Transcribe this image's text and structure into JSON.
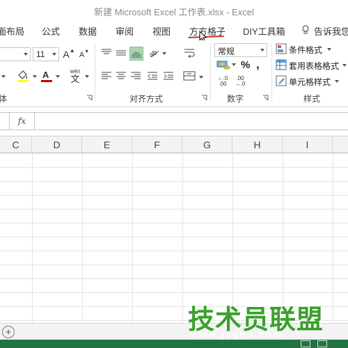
{
  "window": {
    "title": "新建 Microsoft Excel 工作表.xlsx - Excel"
  },
  "ribbon_tabs": [
    {
      "label": "面布局"
    },
    {
      "label": "公式"
    },
    {
      "label": "数据"
    },
    {
      "label": "审阅"
    },
    {
      "label": "视图"
    },
    {
      "label": "方方格子",
      "active": true
    },
    {
      "label": "DIY工具箱"
    },
    {
      "label": "告诉我您"
    }
  ],
  "font_group": {
    "font_size": "11",
    "grow_label": "A",
    "shrink_label": "A",
    "phonetic_label": "wén",
    "phonetic_char": "文",
    "fill_color": "#ffff00",
    "font_color": "#c00000",
    "group_label": "体"
  },
  "alignment_group": {
    "group_label": "对齐方式"
  },
  "number_group": {
    "format_value": "常规",
    "percent_label": "%",
    "comma_label": ",",
    "inc_decimal_top": "←.0",
    "inc_decimal_bottom": ".00",
    "dec_decimal_top": ".00",
    "dec_decimal_bottom": "→.0",
    "group_label": "数字"
  },
  "styles_group": {
    "conditional_format": "条件格式",
    "format_as_table": "套用表格格式",
    "cell_styles": "单元格样式",
    "group_label": "样式"
  },
  "formula_bar": {
    "fx_label": "fx",
    "value": ""
  },
  "columns": [
    "C",
    "D",
    "E",
    "F",
    "G",
    "H",
    "I"
  ],
  "sheet_bar": {
    "add_label": "+"
  },
  "watermark": {
    "big": "技术员联盟",
    "small": "www.jsgho.com"
  },
  "colors": {
    "excel_green": "#217346",
    "active_align": "#a8d5b0",
    "tab_underline": "#c0392b",
    "watermark_green": "#3aa12c"
  }
}
